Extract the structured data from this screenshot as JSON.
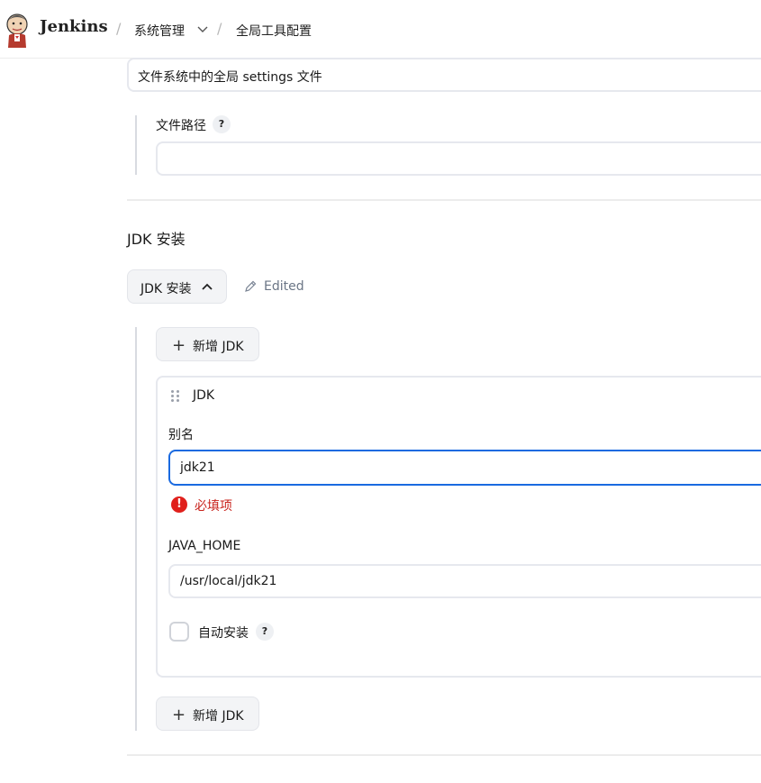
{
  "header": {
    "brand": "Jenkins",
    "separator": "/",
    "breadcrumbs": [
      "系统管理",
      "全局工具配置"
    ]
  },
  "settings": {
    "selected_option": "文件系统中的全局 settings 文件",
    "file_path_label": "文件路径",
    "file_path_value": "",
    "help_glyph": "?"
  },
  "jdk_section": {
    "title": "JDK 安装",
    "toggle_label": "JDK 安装",
    "edited_label": "Edited",
    "add_button_label": "新增 JDK",
    "item": {
      "heading": "JDK",
      "alias_label": "别名",
      "alias_value": "jdk21",
      "error_message": "必填项",
      "java_home_label": "JAVA_HOME",
      "java_home_value": "/usr/local/jdk21",
      "auto_install_label": "自动安装",
      "auto_install_checked": false
    }
  },
  "colors": {
    "accent": "#1a6ae0",
    "error": "#e0201c",
    "border": "#e6e8ee"
  }
}
